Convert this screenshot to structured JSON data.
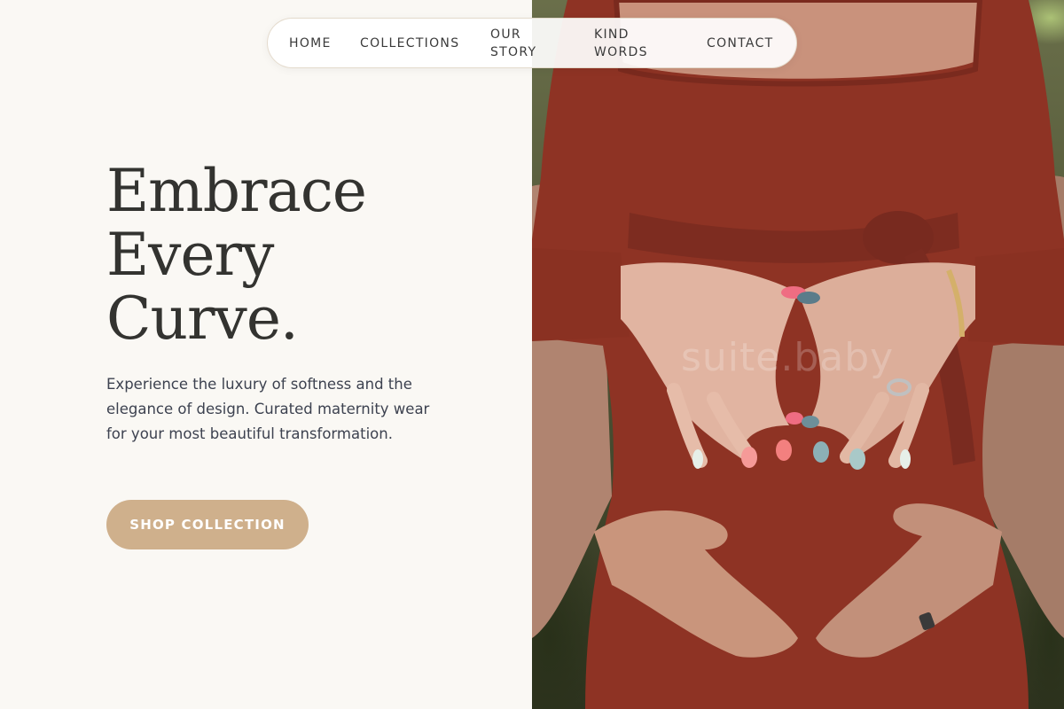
{
  "nav": {
    "items": [
      {
        "label": "HOME"
      },
      {
        "label": "COLLECTIONS"
      },
      {
        "label": "OUR STORY"
      },
      {
        "label": "KIND WORDS"
      },
      {
        "label": "CONTACT"
      }
    ]
  },
  "hero": {
    "title_lines": [
      "Embrace",
      "Every",
      "Curve."
    ],
    "description": "Experience the luxury of softness and the elegance of design. Curated maternity wear for your most beautiful transformation.",
    "cta_label": "SHOP COLLECTION"
  },
  "photo": {
    "watermark": "suite.baby",
    "subject": "maternity-photo-heart-hands"
  },
  "colors": {
    "background": "#faf8f4",
    "accent": "#cfb08c",
    "text_dark": "#333330",
    "dress": "#8e3324"
  }
}
